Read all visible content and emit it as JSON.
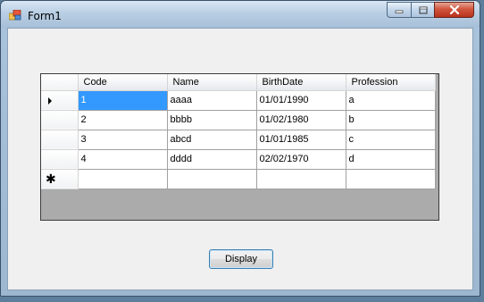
{
  "window": {
    "title": "Form1",
    "icon": "form-app-icon",
    "controls": {
      "minimize": "minimize-icon",
      "maximize": "maximize-icon",
      "close": "close-icon"
    }
  },
  "grid": {
    "columns": [
      "Code",
      "Name",
      "BirthDate",
      "Profession"
    ],
    "rows": [
      {
        "code": "1",
        "name": "aaaa",
        "birthdate": "01/01/1990",
        "profession": "a"
      },
      {
        "code": "2",
        "name": "bbbb",
        "birthdate": "01/02/1980",
        "profession": "b"
      },
      {
        "code": "3",
        "name": "abcd",
        "birthdate": "01/01/1985",
        "profession": "c"
      },
      {
        "code": "4",
        "name": "dddd",
        "birthdate": "02/02/1970",
        "profession": "d"
      }
    ],
    "current_row_marker": "row-arrow-icon",
    "new_row_marker": "new-row-star-icon",
    "new_row_glyph": "✱",
    "selected_color": "#3399ff"
  },
  "buttons": {
    "display_label": "Display"
  }
}
